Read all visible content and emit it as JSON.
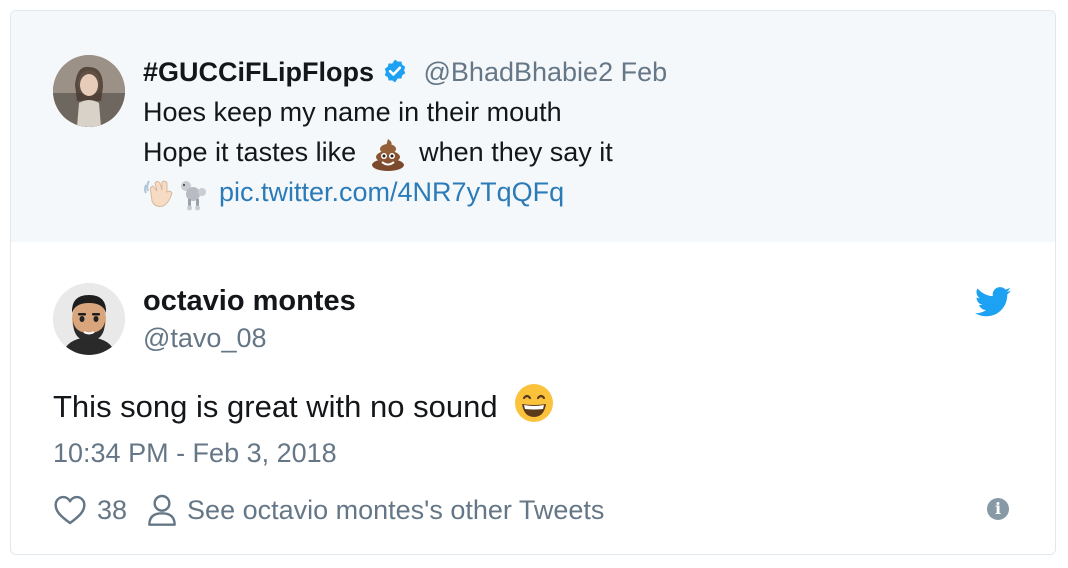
{
  "quoted_tweet": {
    "display_name": "#GUCCiFLipFlops",
    "handle": "@BhadBhabie",
    "date": "2 Feb",
    "line1": "Hoes keep my name in their mouth",
    "line2_before": "Hope it tastes like",
    "line2_after": "when they say it",
    "link": "pic.twitter.com/4NR7yTqQFq"
  },
  "tweet": {
    "display_name": "octavio montes",
    "handle": "@tavo_08",
    "text": "This song is great with no sound",
    "timestamp": "10:34 PM - Feb 3, 2018",
    "like_count": "38",
    "other_tweets_link": "See octavio montes's other Tweets"
  },
  "icons": {
    "verified": "verified-badge-icon",
    "twitter": "twitter-bird-icon",
    "like": "heart-icon",
    "profile": "person-icon",
    "info": "info-icon"
  },
  "colors": {
    "link_blue": "#2b7bb9",
    "twitter_blue": "#1da1f2",
    "muted_gray": "#657786",
    "quoted_bg": "#f5f8fa"
  }
}
